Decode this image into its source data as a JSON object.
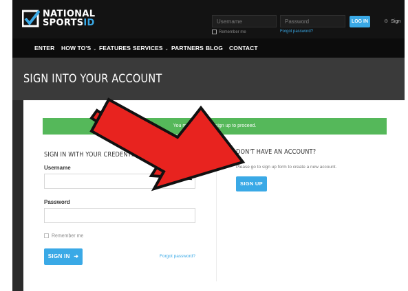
{
  "header": {
    "logo_line1": "NATIONAL",
    "logo_line2_main": "SPORTS",
    "logo_line2_accent": "ID",
    "username_placeholder": "Username",
    "password_placeholder": "Password",
    "remember_label": "Remember me",
    "forgot_label": "Forgot password?",
    "login_label": "LOG IN",
    "sign_label": "Sign"
  },
  "nav": {
    "items": [
      {
        "label": "ENTER",
        "caret": ""
      },
      {
        "label": "HOW TO'S",
        "caret": "⌄"
      },
      {
        "label": "FEATURES",
        "caret": ""
      },
      {
        "label": "SERVICES",
        "caret": "⌄"
      },
      {
        "label": "PARTNERS",
        "caret": ""
      },
      {
        "label": "BLOG",
        "caret": ""
      },
      {
        "label": "CONTACT",
        "caret": ""
      }
    ]
  },
  "page": {
    "title": "SIGN INTO YOUR ACCOUNT"
  },
  "alert": {
    "text": "You must sign in or sign up to proceed."
  },
  "signin": {
    "heading": "SIGN IN WITH YOUR CREDENTIALS",
    "username_label": "Username",
    "password_label": "Password",
    "remember_label": "Remember me",
    "button_label": "SIGN IN",
    "button_icon": "sign-in-arrow-icon",
    "forgot_label": "Forgot password?"
  },
  "signup": {
    "heading": "DON'T HAVE AN ACCOUNT?",
    "text": "Please go to sign up form to create a new account.",
    "button_label": "SIGN UP"
  },
  "colors": {
    "accent": "#3aa9e6",
    "alert_green": "#55b85a",
    "arrow_red": "#e8231f"
  }
}
